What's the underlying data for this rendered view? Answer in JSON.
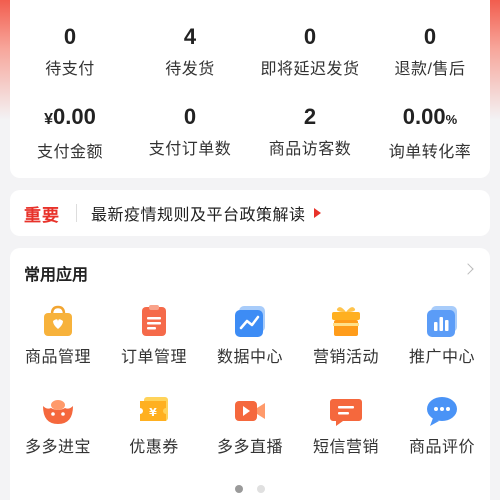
{
  "stats": [
    {
      "value": "0",
      "label": "待支付"
    },
    {
      "value": "4",
      "label": "待发货"
    },
    {
      "value": "0",
      "label": "即将延迟发货"
    },
    {
      "value": "0",
      "label": "退款/售后"
    },
    {
      "unit": "¥",
      "value": "0.00",
      "label": "支付金额"
    },
    {
      "value": "0",
      "label": "支付订单数"
    },
    {
      "value": "2",
      "label": "商品访客数"
    },
    {
      "value": "0.00",
      "pct": "%",
      "label": "询单转化率"
    }
  ],
  "notice": {
    "tag": "重要",
    "text": "最新疫情规则及平台政策解读"
  },
  "apps": {
    "title": "常用应用",
    "items": [
      {
        "label": "商品管理",
        "icon": "shopping-bag-icon"
      },
      {
        "label": "订单管理",
        "icon": "order-clipboard-icon"
      },
      {
        "label": "数据中心",
        "icon": "line-chart-icon"
      },
      {
        "label": "营销活动",
        "icon": "gift-icon"
      },
      {
        "label": "推广中心",
        "icon": "bar-chart-icon"
      },
      {
        "label": "多多进宝",
        "icon": "treasure-ingot-icon"
      },
      {
        "label": "优惠券",
        "icon": "coupon-icon"
      },
      {
        "label": "多多直播",
        "icon": "video-camera-icon"
      },
      {
        "label": "短信营销",
        "icon": "message-icon"
      },
      {
        "label": "商品评价",
        "icon": "comment-bubble-icon"
      }
    ]
  },
  "pager": {
    "total": 2,
    "active": 0
  },
  "colors": {
    "accent": "#e8322a",
    "orange": "#ff7a2f",
    "blue": "#3d8cf5"
  }
}
